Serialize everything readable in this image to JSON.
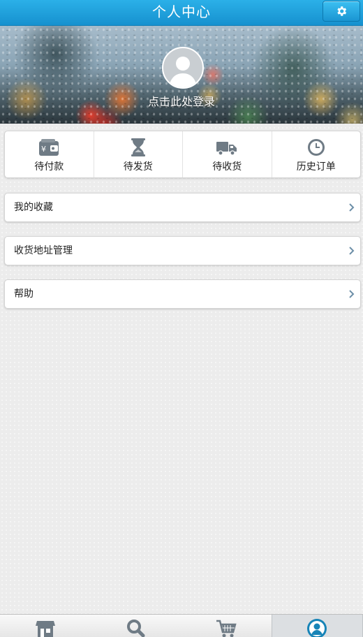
{
  "header": {
    "title": "个人中心",
    "settings_icon": "gear-icon"
  },
  "profile": {
    "login_text": "点击此处登录",
    "avatar_icon": "user-silhouette-icon"
  },
  "orders": [
    {
      "label": "待付款",
      "icon": "wallet-icon"
    },
    {
      "label": "待发货",
      "icon": "hourglass-icon"
    },
    {
      "label": "待收货",
      "icon": "truck-icon"
    },
    {
      "label": "历史订单",
      "icon": "clock-icon"
    }
  ],
  "menu": [
    {
      "label": "我的收藏",
      "icon": "chevron-right-icon"
    },
    {
      "label": "收货地址管理",
      "icon": "chevron-right-icon"
    },
    {
      "label": "帮助",
      "icon": "chevron-right-icon"
    }
  ],
  "tabbar": {
    "tabs": [
      {
        "name": "store",
        "icon": "store-icon",
        "active": false
      },
      {
        "name": "search",
        "icon": "search-icon",
        "active": false
      },
      {
        "name": "cart",
        "icon": "cart-icon",
        "active": false
      },
      {
        "name": "profile",
        "icon": "user-circle-icon",
        "active": true
      }
    ]
  },
  "colors": {
    "header_blue": "#1ea3e0",
    "icon_gray": "#6f7b85",
    "chevron_blue": "#6d8fa8",
    "active_tab_icon": "#1784b7"
  }
}
